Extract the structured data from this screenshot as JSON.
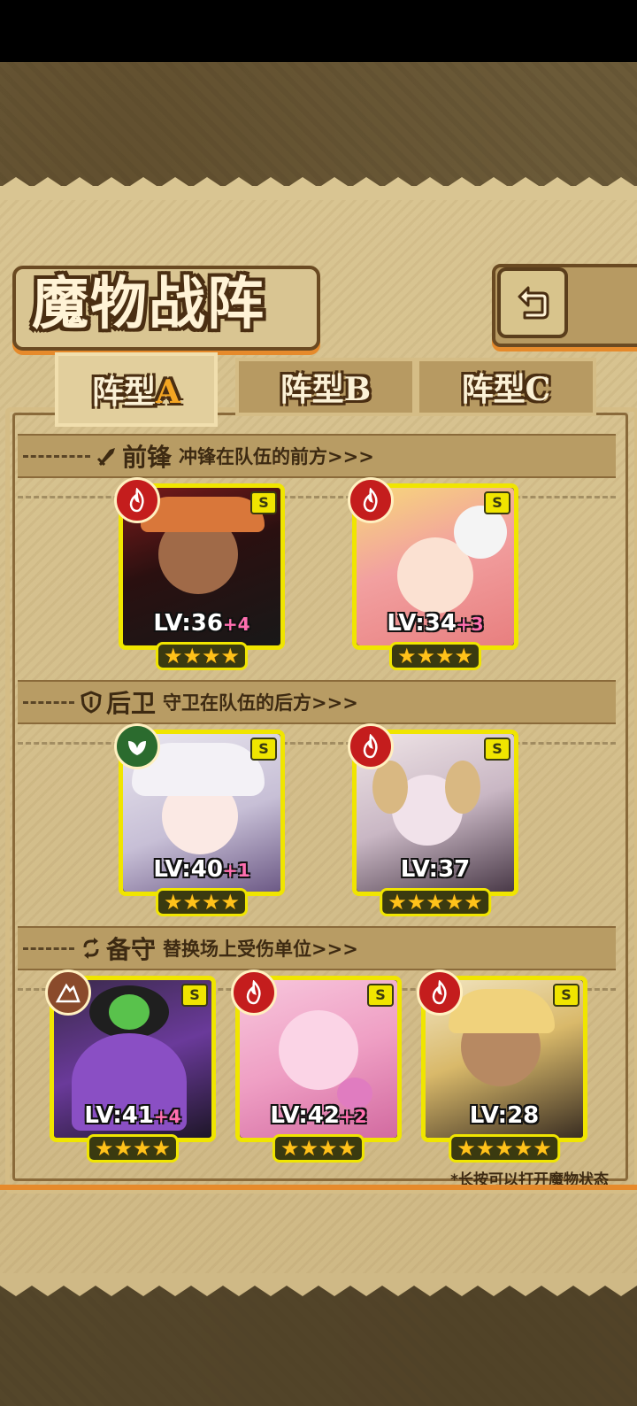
{
  "title": "魔物战阵",
  "back_icon": "back-arrow-icon",
  "tabs": [
    {
      "name": "阵型",
      "letter": "A",
      "active": true
    },
    {
      "name": "阵型",
      "letter": "B",
      "active": false
    },
    {
      "name": "阵型",
      "letter": "C",
      "active": false
    }
  ],
  "sections": {
    "front": {
      "title": "前锋",
      "desc": "冲锋在队伍的前方>>>",
      "icon": "sword-icon"
    },
    "back": {
      "title": "后卫",
      "desc": "守卫在队伍的后方>>>",
      "icon": "shield-icon"
    },
    "reserve": {
      "title": "备守",
      "desc": "替换场上受伤单位>>>",
      "icon": "swap-icon"
    }
  },
  "monsters": {
    "front": [
      {
        "lv": "LV:36",
        "plus": "+4",
        "rank": "S",
        "element": "fire",
        "stars": 4
      },
      {
        "lv": "LV:34",
        "plus": "+3",
        "rank": "S",
        "element": "fire",
        "stars": 4
      }
    ],
    "back": [
      {
        "lv": "LV:40",
        "plus": "+1",
        "rank": "S",
        "element": "leaf",
        "stars": 4
      },
      {
        "lv": "LV:37",
        "plus": "",
        "rank": "S",
        "element": "fire",
        "stars": 5
      }
    ],
    "reserve": [
      {
        "lv": "LV:41",
        "plus": "+4",
        "rank": "S",
        "element": "rock",
        "stars": 4
      },
      {
        "lv": "LV:42",
        "plus": "+2",
        "rank": "S",
        "element": "fire",
        "stars": 4
      },
      {
        "lv": "LV:28",
        "plus": "",
        "rank": "S",
        "element": "fire",
        "stars": 5
      }
    ]
  },
  "hint": "*长按可以打开魔物状态",
  "colors": {
    "accent": "#e68a2b",
    "card_border": "#f0e500",
    "fire": "#c41d1d",
    "leaf": "#2b6b2e",
    "rock": "#8a4a2b"
  }
}
